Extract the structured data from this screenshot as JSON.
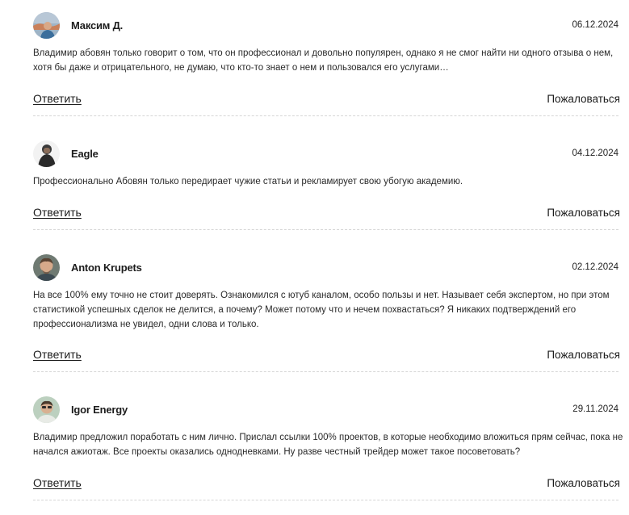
{
  "comments": [
    {
      "author": "Максим Д.",
      "date": "06.12.2024",
      "avatar_icon": "user-avatar-icon",
      "text": "Владимир абовян только говорит о том, что он профессионал и довольно популярен, однако я не смог найти ни одного отзыва о нем, хотя бы даже и отрицательного, не думаю, что кто-то знает о нем и пользовался его услугами…",
      "reply_label": "Ответить",
      "report_label": "Пожаловаться"
    },
    {
      "author": "Eagle",
      "date": "04.12.2024",
      "avatar_icon": "user-avatar-icon",
      "text": "Профессионально Абовян только передирает чужие статьи и рекламирует свою убогую академию.",
      "reply_label": "Ответить",
      "report_label": "Пожаловаться"
    },
    {
      "author": "Anton Krupets",
      "date": "02.12.2024",
      "avatar_icon": "user-avatar-icon",
      "text": "На все 100% ему точно не стоит доверять. Ознакомился с ютуб каналом, особо пользы и нет. Называет себя экспертом, но при этом статистикой успешных сделок не делится, а почему? Может потому что и нечем похвастаться? Я никаких подтверждений его профессионализма не увидел, одни слова и только.",
      "reply_label": "Ответить",
      "report_label": "Пожаловаться"
    },
    {
      "author": "Igor Energy",
      "date": "29.11.2024",
      "avatar_icon": "user-avatar-icon",
      "text": "Владимир предложил поработать с ним лично. Прислал ссылки 100% проектов, в которые необходимо вложиться прям сейчас, пока не начался ажиотаж. Все проекты оказались однодневками. Ну разве честный трейдер может такое посоветовать?",
      "reply_label": "Ответить",
      "report_label": "Пожаловаться"
    }
  ],
  "colors": {
    "text": "#222222",
    "divider": "#d6d6d6"
  }
}
